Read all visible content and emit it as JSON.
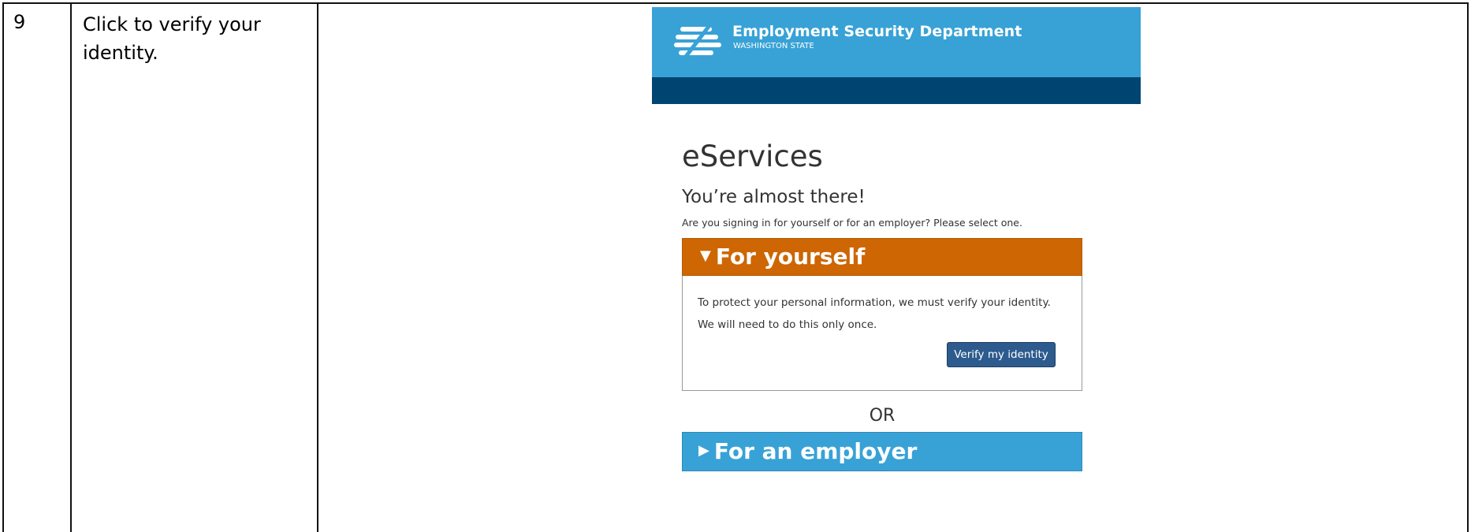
{
  "step": {
    "number": "9",
    "instruction": "Click to verify your identity."
  },
  "site": {
    "logo_icon": "esd-logo-icon",
    "brand_name": "Employment Security Department",
    "brand_sub": "WASHINGTON STATE",
    "header_color": "#38a2d6",
    "bar_color": "#004571"
  },
  "page": {
    "title": "eServices",
    "subtitle": "You’re almost there!",
    "prompt": "Are you signing in for yourself or for an employer? Please select one."
  },
  "panel_yourself": {
    "caret_icon": "caret-down-icon",
    "label": "For yourself",
    "color": "#cd6603",
    "line1": "To protect your personal information, we must verify your identity.",
    "line2": "We will need to do this only once.",
    "button_label": "Verify my identity",
    "button_color": "#2d5b8e"
  },
  "or_label": "OR",
  "panel_employer": {
    "caret_icon": "caret-right-icon",
    "label": "For an employer",
    "color": "#38a2d6"
  }
}
